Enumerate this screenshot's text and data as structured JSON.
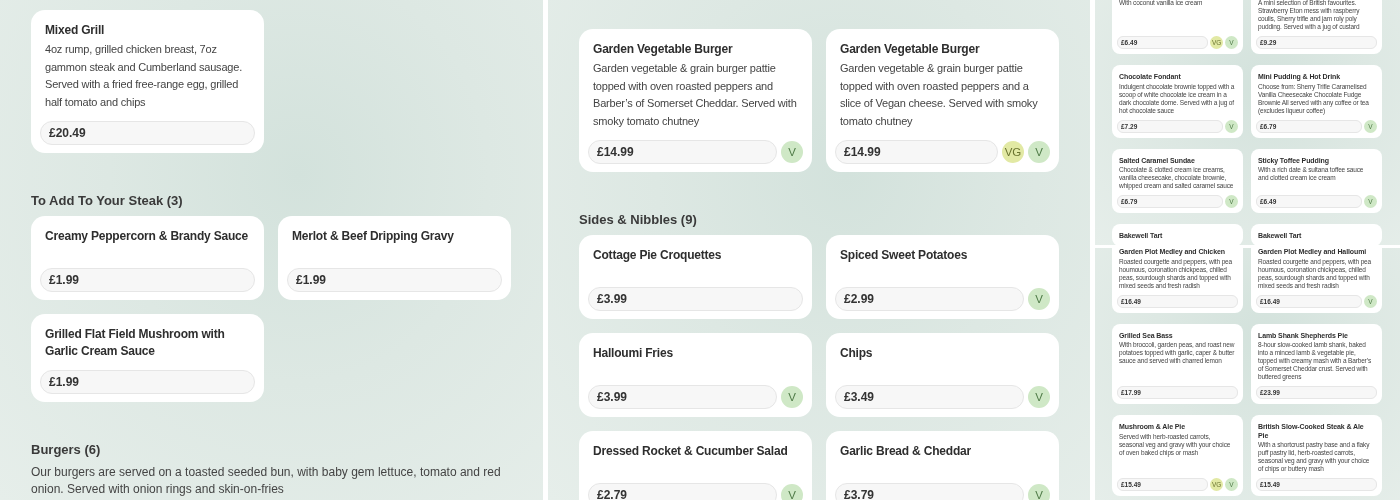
{
  "panels": [
    {
      "kind": "full",
      "views": [
        {
          "blocks": [
            {
              "kind": "cards",
              "cards": [
                {
                  "title": "Mixed Grill",
                  "description": "4oz rump, grilled chicken breast, 7oz gammon steak and Cumberland sausage. Served with a fried free-range egg, grilled half tomato and chips",
                  "price": "£20.49"
                }
              ]
            },
            {
              "kind": "heading",
              "text": "To Add To Your Steak (3)"
            },
            {
              "kind": "cards",
              "cards": [
                {
                  "title": "Creamy Peppercorn & Brandy Sauce",
                  "price": "£1.99"
                },
                {
                  "title": "Merlot & Beef Dripping Gravy",
                  "price": "£1.99"
                },
                {
                  "title": "Grilled Flat Field Mushroom with Garlic Cream Sauce",
                  "price": "£1.99"
                }
              ]
            },
            {
              "kind": "heading",
              "text": "Burgers (6)"
            },
            {
              "kind": "note",
              "text": "Our burgers are served on a toasted seeded bun, with baby gem lettuce, tomato and red onion. Served with onion rings and skin-on-fries"
            }
          ]
        }
      ]
    },
    {
      "kind": "full",
      "views": [
        {
          "blocks": [
            {
              "kind": "cards",
              "cards": [
                {
                  "title": "Garden Vegetable Burger",
                  "description": "Garden vegetable & grain burger pattie topped with oven roasted peppers and Barber’s of Somerset Cheddar. Served with smoky tomato chutney",
                  "price": "£14.99",
                  "badges": [
                    {
                      "label": "V",
                      "kind": "vegetarian"
                    }
                  ]
                },
                {
                  "title": "Garden Vegetable Burger",
                  "description": "Garden vegetable & grain burger pattie topped with oven roasted peppers and a slice of Vegan cheese. Served with smoky tomato chutney",
                  "price": "£14.99",
                  "badges": [
                    {
                      "label": "VG",
                      "kind": "vegan"
                    },
                    {
                      "label": "V",
                      "kind": "vegetarian"
                    }
                  ]
                }
              ]
            },
            {
              "kind": "heading",
              "text": "Sides & Nibbles (9)"
            },
            {
              "kind": "cards",
              "cards": [
                {
                  "title": "Cottage Pie Croquettes",
                  "price": "£3.99"
                },
                {
                  "title": "Spiced Sweet Potatoes",
                  "price": "£2.99",
                  "badges": [
                    {
                      "label": "V",
                      "kind": "vegetarian"
                    }
                  ]
                },
                {
                  "title": "Halloumi Fries",
                  "price": "£3.99",
                  "badges": [
                    {
                      "label": "V",
                      "kind": "vegetarian"
                    }
                  ]
                },
                {
                  "title": "Chips",
                  "price": "£3.49",
                  "badges": [
                    {
                      "label": "V",
                      "kind": "vegetarian"
                    }
                  ]
                },
                {
                  "title": "Dressed Rocket & Cucumber Salad",
                  "price": "£2.79",
                  "badges": [
                    {
                      "label": "V",
                      "kind": "vegetarian"
                    }
                  ]
                },
                {
                  "title": "Garlic Bread & Cheddar",
                  "price": "£3.79",
                  "badges": [
                    {
                      "label": "V",
                      "kind": "vegetarian"
                    }
                  ]
                }
              ]
            }
          ]
        }
      ]
    },
    {
      "kind": "compact",
      "views": [
        {
          "blocks": [
            {
              "kind": "cards",
              "cards": [
                {
                  "description": "With coconut vanilla ice cream",
                  "price": "£6.49",
                  "badges": [
                    {
                      "label": "VG",
                      "kind": "vegan"
                    },
                    {
                      "label": "V",
                      "kind": "vegetarian"
                    }
                  ]
                },
                {
                  "description": "A mini selection of British favourites. Strawberry Eton mess with raspberry coulis, Sherry trifle and jam roly poly pudding. Served with a jug of custard",
                  "price": "£9.29"
                },
                {
                  "title": "Chocolate Fondant",
                  "description": "Indulgent chocolate brownie topped with a scoop of white chocolate ice cream in a dark chocolate dome. Served with a jug of hot chocolate sauce",
                  "price": "£7.29",
                  "badges": [
                    {
                      "label": "V",
                      "kind": "vegetarian"
                    }
                  ]
                },
                {
                  "title": "Mini Pudding & Hot Drink",
                  "description": "Choose from: Sherry Trifle Caramelised Vanilla Cheesecake Chocolate Fudge Brownie All served with any coffee or tea (excludes liqueur coffee)",
                  "price": "£6.79",
                  "badges": [
                    {
                      "label": "V",
                      "kind": "vegetarian"
                    }
                  ]
                },
                {
                  "title": "Salted Caramel Sundae",
                  "description": "Chocolate & clotted cream ice creams, vanilla cheesecake, chocolate brownie, whipped cream and salted caramel sauce",
                  "price": "£6.79",
                  "badges": [
                    {
                      "label": "V",
                      "kind": "vegetarian"
                    }
                  ]
                },
                {
                  "title": "Sticky Toffee Pudding",
                  "description": "With a rich date & sultana toffee sauce and clotted cream ice cream",
                  "price": "£6.49",
                  "badges": [
                    {
                      "label": "V",
                      "kind": "vegetarian"
                    }
                  ]
                },
                {
                  "title": "Bakewell Tart"
                },
                {
                  "title": "Bakewell Tart"
                }
              ]
            }
          ]
        },
        {
          "blocks": [
            {
              "kind": "cards",
              "cards": [
                {
                  "title": "Garden Plot Medley and Chicken",
                  "description": "Roasted courgette and peppers, with pea houmous, coronation chickpeas, chilled peas, sourdough shards and topped with mixed seeds and fresh radish",
                  "price": "£16.49"
                },
                {
                  "title": "Garden Plot Medley and Halloumi",
                  "description": "Roasted courgette and peppers, with pea houmous, coronation chickpeas, chilled peas, sourdough shards and topped with mixed seeds and fresh radish",
                  "price": "£16.49",
                  "badges": [
                    {
                      "label": "V",
                      "kind": "vegetarian"
                    }
                  ]
                },
                {
                  "title": "Grilled Sea Bass",
                  "description": "With broccoli, garden peas, and roast new potatoes topped with garlic, caper & butter sauce and served with charred lemon",
                  "price": "£17.99"
                },
                {
                  "title": "Lamb Shank Shepherds Pie",
                  "description": "8-hour slow-cooked lamb shank, baked into a minced lamb & vegetable pie, topped with creamy mash with a Barber’s of Somerset Cheddar crust. Served with buttered greens",
                  "price": "£23.99"
                },
                {
                  "title": "Mushroom & Ale Pie",
                  "description": "Served with herb-roasted carrots, seasonal veg and gravy with your choice of oven baked chips or mash",
                  "price": "£15.49",
                  "badges": [
                    {
                      "label": "VG",
                      "kind": "vegan"
                    },
                    {
                      "label": "V",
                      "kind": "vegetarian"
                    }
                  ]
                },
                {
                  "title": "British Slow-Cooked Steak & Ale Pie",
                  "description": "With a shortcrust pastry base and a flaky puff pastry lid, herb-roasted carrots, seasonal veg and gravy with your choice of chips or buttery mash",
                  "price": "£15.49"
                }
              ]
            }
          ]
        }
      ]
    }
  ]
}
